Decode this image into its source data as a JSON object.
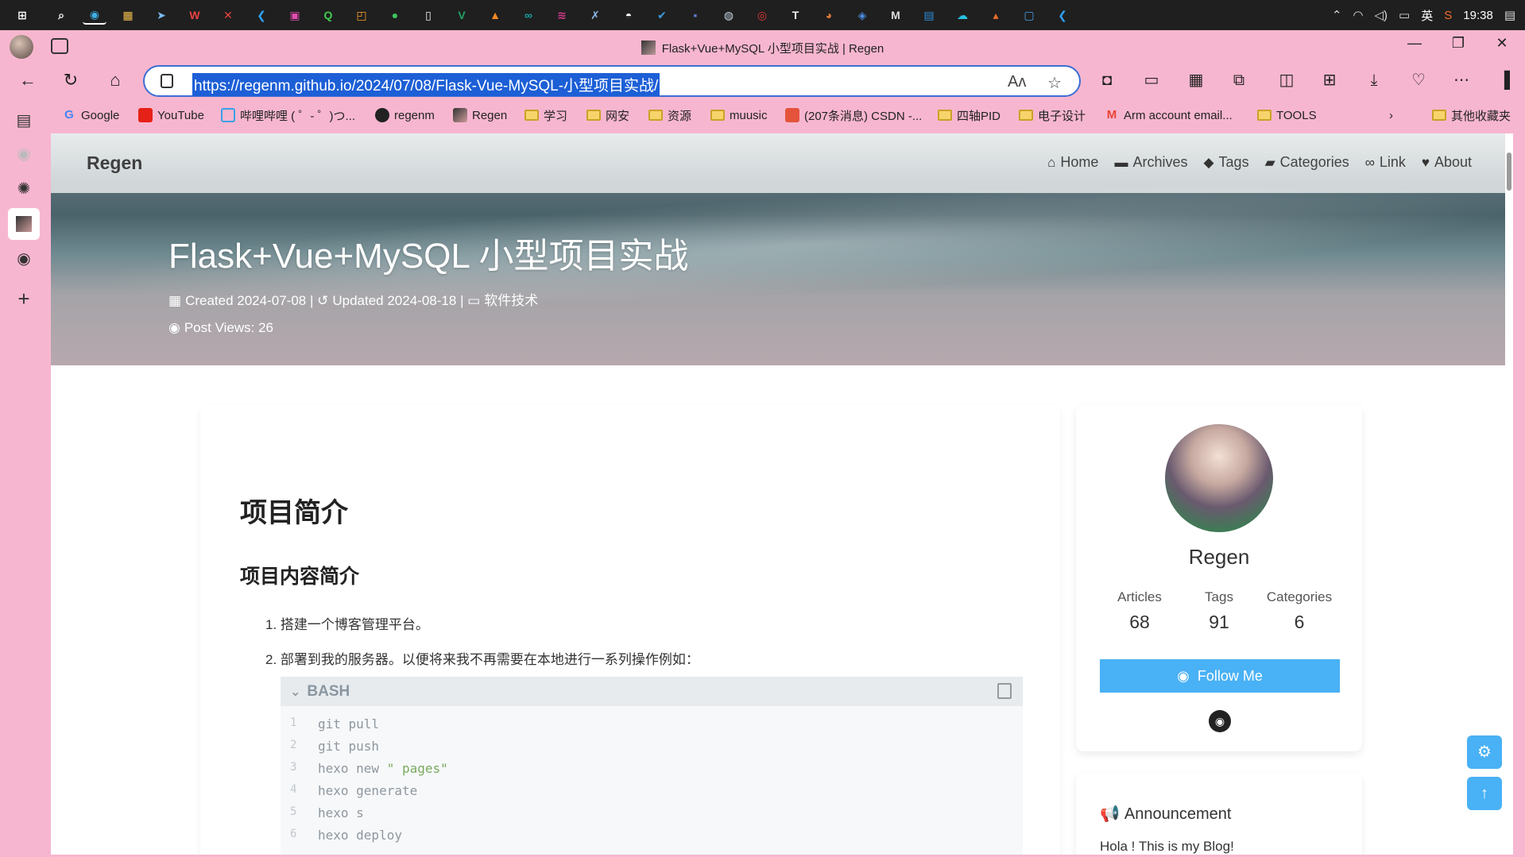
{
  "taskbar": {
    "icons": [
      "windows-start",
      "search",
      "edge",
      "files",
      "explorer-arrow",
      "wps",
      "xmind",
      "vscode",
      "app-pink",
      "qt",
      "app-orange",
      "wechat",
      "notepad",
      "excel",
      "app-orange-2",
      "arduino",
      "app-red",
      "app-blue-x",
      "qq",
      "app-blue-check",
      "app-dark",
      "steam",
      "netease-music",
      "typora",
      "app-bear",
      "app-blue",
      "app-m",
      "mx",
      "app-cloud",
      "app-matlab",
      "app-window",
      "vscode-2"
    ],
    "clock": "19:38",
    "ime": "英"
  },
  "browser": {
    "tab_title": "Flask+Vue+MySQL 小型项目实战 | Regen",
    "url": "https://regenm.github.io/2024/07/08/Flask-Vue-MySQL-小型项目实战/",
    "bookmarks": [
      {
        "label": "Google",
        "icon": "google-icon"
      },
      {
        "label": "YouTube",
        "icon": "youtube-icon"
      },
      {
        "label": "哔哩哔哩 ( ゜- ゜)つ...",
        "icon": "bilibili-icon"
      },
      {
        "label": "regenm",
        "icon": "github-icon"
      },
      {
        "label": "Regen",
        "icon": "regen-favicon"
      },
      {
        "label": "学习",
        "icon": "folder-icon"
      },
      {
        "label": "网安",
        "icon": "folder-icon"
      },
      {
        "label": "资源",
        "icon": "folder-icon"
      },
      {
        "label": "muusic",
        "icon": "folder-icon"
      },
      {
        "label": "(207条消息) CSDN -...",
        "icon": "csdn-icon"
      },
      {
        "label": "四轴PID",
        "icon": "folder-icon"
      },
      {
        "label": "电子设计",
        "icon": "folder-icon"
      },
      {
        "label": "Arm account email...",
        "icon": "gmail-icon"
      },
      {
        "label": "TOOLS",
        "icon": "folder-icon"
      }
    ],
    "other_bookmarks": "其他收藏夹"
  },
  "site": {
    "brand": "Regen",
    "menu": [
      {
        "label": "Home",
        "icon": "home-icon"
      },
      {
        "label": "Archives",
        "icon": "archive-icon"
      },
      {
        "label": "Tags",
        "icon": "tag-icon"
      },
      {
        "label": "Categories",
        "icon": "folder-open-icon"
      },
      {
        "label": "Link",
        "icon": "link-icon"
      },
      {
        "label": "About",
        "icon": "heart-icon"
      }
    ]
  },
  "post": {
    "title": "Flask+Vue+MySQL 小型项目实战",
    "created": "Created 2024-07-08",
    "updated": "Updated 2024-08-18",
    "category": "软件技术",
    "views": "Post Views: 26",
    "h1": "项目简介",
    "h2": "项目内容简介",
    "list": [
      "1. 搭建一个博客管理平台。",
      "2. 部署到我的服务器。以便将来我不再需要在本地进行一系列操作例如："
    ],
    "code": {
      "lang": "BASH",
      "lines": [
        {
          "n": "1",
          "text": "git pull",
          "str": ""
        },
        {
          "n": "2",
          "text": "git push",
          "str": ""
        },
        {
          "n": "3",
          "text": "hexo new ",
          "str": "\" pages\""
        },
        {
          "n": "4",
          "text": "hexo generate",
          "str": ""
        },
        {
          "n": "5",
          "text": "hexo s",
          "str": ""
        },
        {
          "n": "6",
          "text": "hexo deploy",
          "str": ""
        }
      ]
    }
  },
  "profile": {
    "name": "Regen",
    "stats": [
      {
        "label": "Articles",
        "value": "68"
      },
      {
        "label": "Tags",
        "value": "91"
      },
      {
        "label": "Categories",
        "value": "6"
      }
    ],
    "follow_label": "Follow Me"
  },
  "announcement": {
    "title": "Announcement",
    "text": "Hola ! This is my Blog!"
  }
}
